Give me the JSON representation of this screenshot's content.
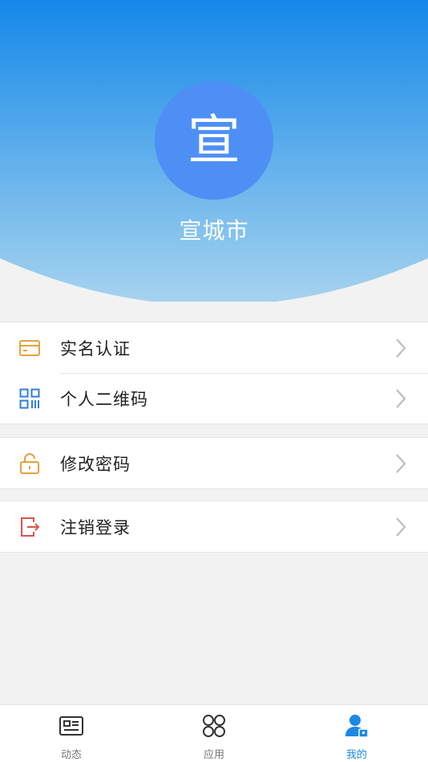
{
  "colors": {
    "header_top": "#1488e9",
    "header_bottom": "#a7d4ee",
    "avatar_bg": "#4e8ff5",
    "accent": "#1e88e5",
    "icon_orange": "#e6a23c",
    "icon_blue": "#2f7ed8",
    "icon_red": "#d9534f"
  },
  "profile": {
    "avatar_char": "宣",
    "name": "宣城市"
  },
  "menu": {
    "realname": {
      "label": "实名认证",
      "icon": "id-card-icon"
    },
    "qrcode": {
      "label": "个人二维码",
      "icon": "qr-code-icon"
    },
    "password": {
      "label": "修改密码",
      "icon": "unlock-icon"
    },
    "logout": {
      "label": "注销登录",
      "icon": "logout-icon"
    }
  },
  "tabbar": {
    "news": {
      "label": "动态",
      "icon": "news-icon"
    },
    "apps": {
      "label": "应用",
      "icon": "apps-icon"
    },
    "mine": {
      "label": "我的",
      "icon": "user-icon",
      "active": true
    }
  }
}
